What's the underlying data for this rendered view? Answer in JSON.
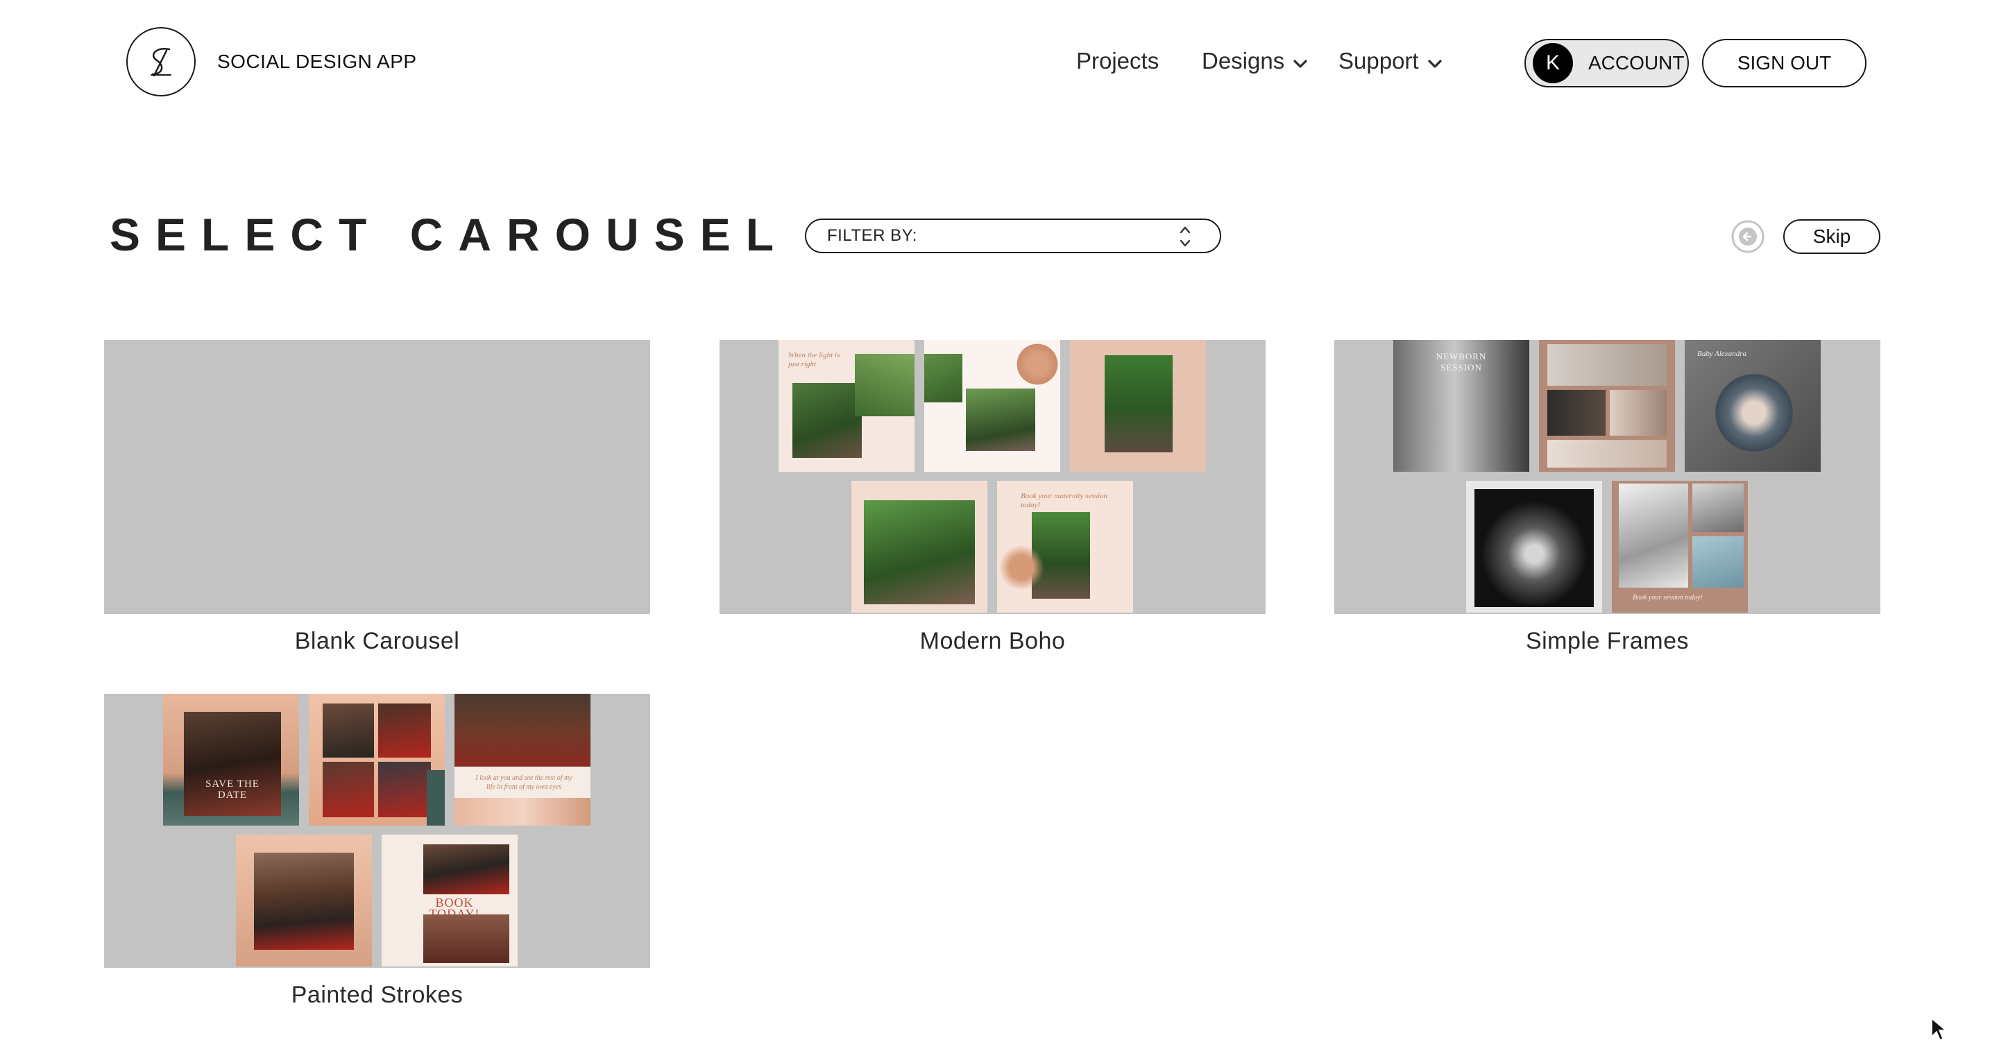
{
  "header": {
    "logo_icon": "stylized-s-logo-icon",
    "app_title": "SOCIAL DESIGN APP",
    "nav": {
      "projects": "Projects",
      "designs": "Designs",
      "support": "Support"
    },
    "account": {
      "avatar_initial": "K",
      "label": "ACCOUNT"
    },
    "sign_out": "SIGN OUT"
  },
  "toolbar": {
    "title": "SELECT CAROUSEL",
    "filter_label": "FILTER BY:",
    "back_icon": "arrow-left-circle-icon",
    "skip": "Skip"
  },
  "templates": [
    {
      "name": "Blank Carousel"
    },
    {
      "name": "Modern Boho",
      "tile_texts": [
        "When the light is just right",
        "Book your maternity session today!"
      ]
    },
    {
      "name": "Simple Frames",
      "tile_texts": [
        "NEWBORN SESSION",
        "Baby Alexandra",
        "Book your session today!"
      ]
    },
    {
      "name": "Painted Strokes",
      "tile_texts": [
        "SAVE THE DATE",
        "I look at you and see the rest of my life in front of my own eyes",
        "BOOK TODAY!"
      ]
    }
  ],
  "colors": {
    "thumb_bg": "#c3c3c3",
    "boho_blush": "#f3ddd3",
    "boho_accent": "#c98b6b",
    "frames_tan": "#b48a78",
    "strokes_teal": "#3f5b55",
    "strokes_red": "#b3261e"
  }
}
